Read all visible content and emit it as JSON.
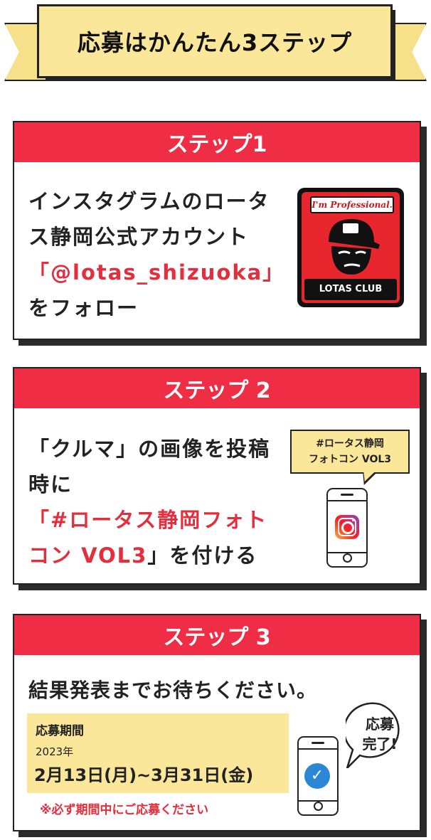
{
  "banner": {
    "title": "応募はかんたん3ステップ"
  },
  "steps": [
    {
      "header": "ステップ1",
      "lines": [
        "インスタグラムのロータ",
        "ス静岡公式アカウント",
        "「@lotas_shizuoka」",
        "をフォロー"
      ],
      "logo_top": "I'm Professional.",
      "logo_bottom": "LOTAS CLUB"
    },
    {
      "header": "ステップ 2",
      "lines": [
        "「クルマ」の画像を投稿",
        "時に",
        "「#ロータス静岡フォト",
        "コン VOL3」を付ける"
      ],
      "bubble": [
        "#ロータス静岡",
        "フォトコン VOL3"
      ]
    },
    {
      "header": "ステップ 3",
      "line": "結果発表までお待ちください。",
      "period_title": "応募期間",
      "period_year": "2023年",
      "period_dates": "2月13日(月)~3月31日(金)",
      "note": "※必ず期間中にご応募ください",
      "shout": [
        "応募",
        "完了!"
      ]
    }
  ],
  "icons": [
    "instagram-icon",
    "check-icon",
    "smartphone-icon"
  ],
  "colors": {
    "red": "#ef2e45",
    "yellow": "#fbe79a",
    "dark": "#222222"
  }
}
